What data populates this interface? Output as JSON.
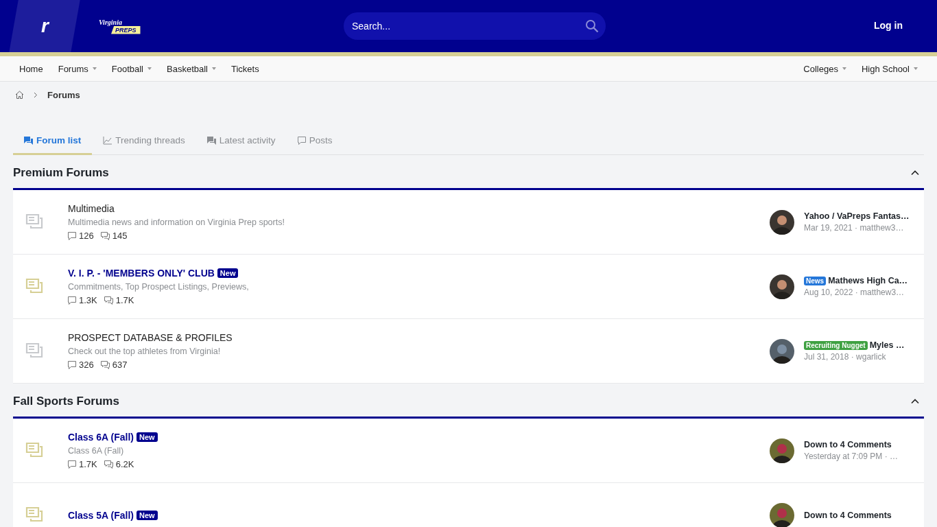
{
  "header": {
    "logo_letter": "r",
    "site_logo": {
      "top": "Virginia",
      "bottom": "PREPS"
    },
    "search": {
      "placeholder": "Search..."
    },
    "login": "Log in"
  },
  "nav": {
    "left": [
      {
        "label": "Home",
        "dropdown": false
      },
      {
        "label": "Forums",
        "dropdown": true
      },
      {
        "label": "Football",
        "dropdown": true
      },
      {
        "label": "Basketball",
        "dropdown": true
      },
      {
        "label": "Tickets",
        "dropdown": false
      }
    ],
    "right": [
      {
        "label": "Colleges",
        "dropdown": true
      },
      {
        "label": "High School",
        "dropdown": true
      }
    ]
  },
  "breadcrumb": {
    "current": "Forums"
  },
  "tabs": [
    {
      "label": "Forum list",
      "selected": true
    },
    {
      "label": "Trending threads",
      "selected": false
    },
    {
      "label": "Latest activity",
      "selected": false
    },
    {
      "label": "Posts",
      "selected": false
    }
  ],
  "sections": [
    {
      "title": "Premium Forums",
      "expanded": true,
      "forums": [
        {
          "title": "Multimedia",
          "unread": false,
          "description": "Multimedia news and information on Virginia Prep sports!",
          "threads": "126",
          "messages": "145",
          "latest": {
            "title": "Yahoo / VaPreps Fantas…",
            "meta": "Mar 19, 2021 · matthew3…"
          }
        },
        {
          "title": "V. I. P. - 'MEMBERS ONLY' CLUB",
          "unread": true,
          "badge": "New",
          "description": "Commitments, Top Prospect Listings, Previews,",
          "threads": "1.3K",
          "messages": "1.7K",
          "latest": {
            "prefix": {
              "label": "News",
              "color": "#2577d9"
            },
            "title": "Mathews High Ca…",
            "meta": "Aug 10, 2022 · matthew3…"
          }
        },
        {
          "title": "PROSPECT DATABASE & PROFILES",
          "unread": false,
          "description": "Check out the top athletes from Virginia!",
          "threads": "326",
          "messages": "637",
          "latest": {
            "prefix": {
              "label": "Recruiting Nugget",
              "color": "#3fa142"
            },
            "title": "Myles …",
            "meta": "Jul 31, 2018 · wgarlick"
          }
        }
      ]
    },
    {
      "title": "Fall Sports Forums",
      "expanded": true,
      "forums": [
        {
          "title": "Class 6A (Fall)",
          "unread": true,
          "badge": "New",
          "description": "Class 6A (Fall)",
          "threads": "1.7K",
          "messages": "6.2K",
          "latest": {
            "title": "Down to 4 Comments",
            "meta": "Yesterday at 7:09 PM · …"
          }
        },
        {
          "title": "Class 5A (Fall)",
          "unread": true,
          "badge": "New",
          "latest": {
            "title": "Down to 4 Comments"
          }
        }
      ]
    }
  ]
}
